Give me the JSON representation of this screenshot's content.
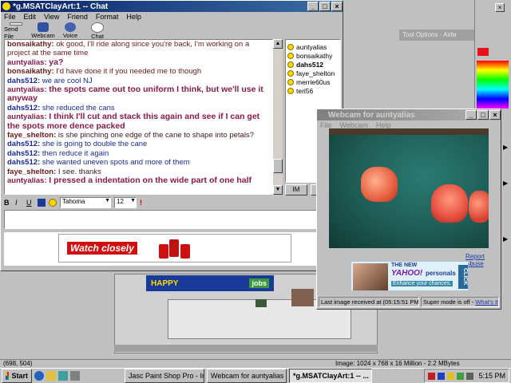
{
  "chat_window": {
    "title": "*g.MSATClayArt:1 -- Chat",
    "menu": [
      "File",
      "Edit",
      "View",
      "Friend",
      "Format",
      "Help"
    ],
    "toolbar": [
      "Send File",
      "Webcam",
      "Voice",
      "Chat"
    ],
    "messages": [
      {
        "nick": "bonsaikathy:",
        "text": "ok good, I'll ride along since you're back, I'm working on a project at the same time",
        "color": "#6b1a1a",
        "nickcolor": "#6b1a1a",
        "bold": false
      },
      {
        "nick": "auntyalias:",
        "text": "ya?",
        "color": "#8b1a4a",
        "nickcolor": "#8b1a4a",
        "bold": true
      },
      {
        "nick": "bonsaikathy:",
        "text": "I'd have done it if you needed me to though",
        "color": "#6b1a1a",
        "nickcolor": "#6b1a1a",
        "bold": false
      },
      {
        "nick": "dahs512:",
        "text": "we are cool NJ",
        "color": "#1a2a9a",
        "nickcolor": "#1a2a9a",
        "bold": false
      },
      {
        "nick": "auntyalias:",
        "text": "the spots came out too uniform I think, but we'll use it anyway",
        "color": "#8b1a4a",
        "nickcolor": "#8b1a4a",
        "bold": true
      },
      {
        "nick": "dahs512:",
        "text": "she reduced the cans",
        "color": "#1a2a9a",
        "nickcolor": "#1a2a9a",
        "bold": false
      },
      {
        "nick": "auntyalias:",
        "text": "I think I'll cut and stack this again and see if I can get the spots more dence packed",
        "color": "#8b1a4a",
        "nickcolor": "#8b1a4a",
        "bold": true
      },
      {
        "nick": "faye_shelton:",
        "text": "is she pinching one edge of the cane to shape into petals?",
        "color": "#3a1a1a",
        "nickcolor": "#6b1a1a",
        "bold": false
      },
      {
        "nick": "dahs512:",
        "text": "she is going to double the cane",
        "color": "#1a2a9a",
        "nickcolor": "#1a2a9a",
        "bold": false
      },
      {
        "nick": "dahs512:",
        "text": "then reduce it again",
        "color": "#1a2a9a",
        "nickcolor": "#1a2a9a",
        "bold": false
      },
      {
        "nick": "dahs512:",
        "text": "she wanted uneven spots and more of them",
        "color": "#1a2a9a",
        "nickcolor": "#1a2a9a",
        "bold": false
      },
      {
        "nick": "faye_shelton:",
        "text": "I see. thanks",
        "color": "#3a1a1a",
        "nickcolor": "#6b1a1a",
        "bold": false
      },
      {
        "nick": "auntyalias:",
        "text": "I pressed a indentation on the wide part of one half",
        "color": "#8b1a4a",
        "nickcolor": "#8b1a4a",
        "bold": true
      }
    ],
    "users": [
      "auntyalias",
      "bonsaikathy",
      "dahs512",
      "faye_shelton",
      "merrie60us",
      "teri56"
    ],
    "im_button": "IM",
    "format": {
      "bold": "B",
      "italic": "I",
      "underline": "U",
      "font": "Tahoma",
      "size": "12"
    },
    "ad_text": "Watch closely"
  },
  "webcam_window": {
    "title": "Webcam for auntyalias",
    "menu": [
      "File",
      "Webcam",
      "Help"
    ],
    "report_abuse": "Report Abuse",
    "ad_line1": "THE NEW",
    "ad_brand": "YAHOO!",
    "ad_word": "personals",
    "ad_tag": "Enhance your chances.",
    "ad_click": "CLICK",
    "last_image": "Last image received at (05:15:51 PM)",
    "super_mode": "Super mode is off -",
    "whats_this": "What's this?"
  },
  "psp": {
    "tool_options": "Tool Options - Airbr",
    "coords": "(698, 504)",
    "image_info": "Image:  1024 x 768 x 16 Million - 2.2 MBytes"
  },
  "background_ad": {
    "jobs": "jobs",
    "happy": "HAPPY"
  },
  "taskbar": {
    "start": "Start",
    "buttons": [
      "Jasc Paint Shop Pro - Ima...",
      "Webcam for auntyalias",
      "*g.MSATClayArt:1 -- ..."
    ],
    "time": "5:15 PM"
  },
  "colors": {
    "titlebar": "#0a246a",
    "desktop": "#c0c0c0"
  }
}
